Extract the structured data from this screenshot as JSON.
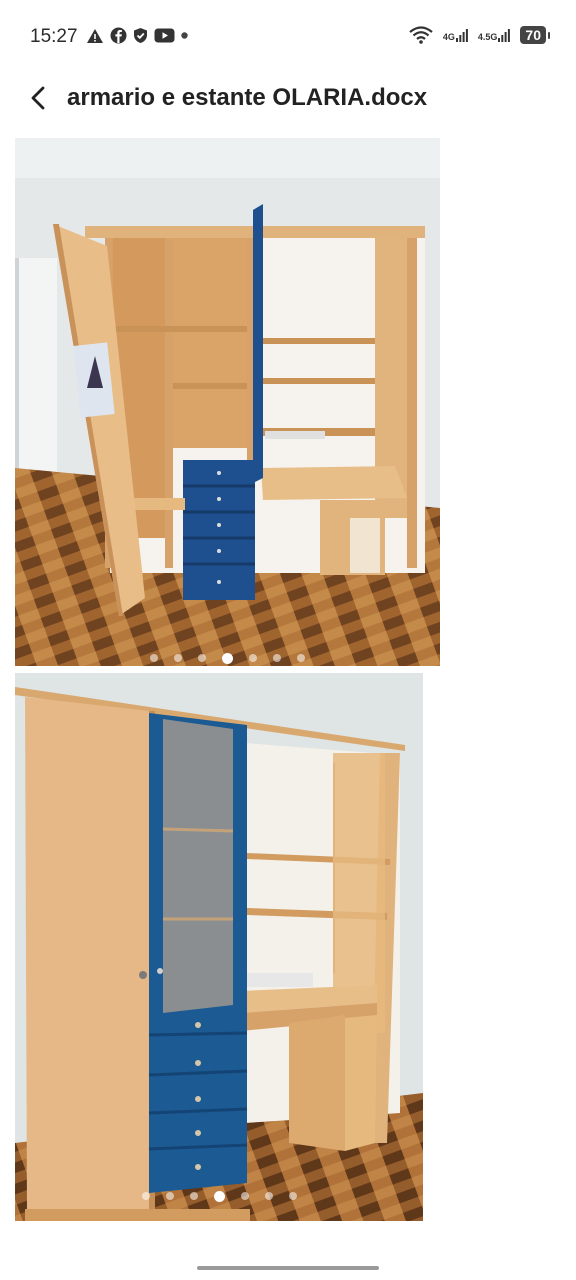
{
  "status_bar": {
    "time": "15:27",
    "left_icons": [
      "warning-icon",
      "facebook-icon",
      "shield-icon",
      "youtube-icon",
      "notification-dot-icon"
    ],
    "network_1": "4G",
    "network_2": "4.5G",
    "battery": "70"
  },
  "header": {
    "title": "armario e estante OLARIA.docx",
    "back_icon": "back-arrow-icon"
  },
  "images": [
    {
      "name": "wardrobe-open-photo",
      "carousel_dots": 7,
      "active_dot": 4
    },
    {
      "name": "wardrobe-closed-photo",
      "carousel_dots": 7,
      "active_dot": 4
    }
  ],
  "colors": {
    "wood": "#e8c194",
    "blue_drawers": "#1d4f8f",
    "floor": "#8b5a2f",
    "wall": "#e6ebec"
  }
}
